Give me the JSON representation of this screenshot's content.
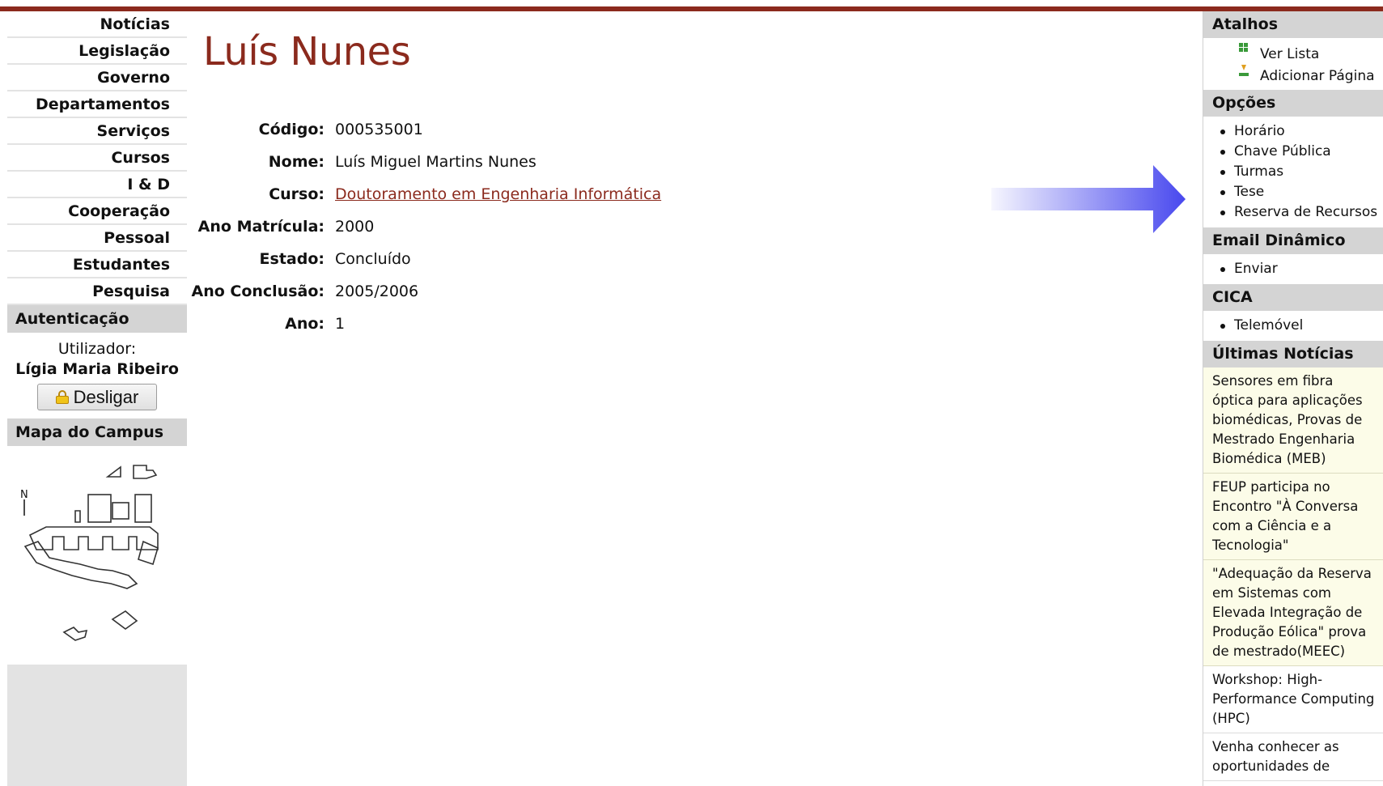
{
  "nav": [
    "Notícias",
    "Legislação",
    "Governo",
    "Departamentos",
    "Serviços",
    "Cursos",
    "I & D",
    "Cooperação",
    "Pessoal",
    "Estudantes",
    "Pesquisa"
  ],
  "auth": {
    "title": "Autenticação",
    "user_label": "Utilizador:",
    "user_name": "Lígia Maria Ribeiro",
    "logout_label": "Desligar"
  },
  "campus_map": {
    "title": "Mapa do Campus",
    "north_label": "N"
  },
  "person": {
    "title": "Luís Nunes",
    "fields": [
      {
        "label": "Código:",
        "value": "000535001"
      },
      {
        "label": "Nome:",
        "value": "Luís Miguel Martins Nunes"
      },
      {
        "label": "Curso:",
        "value": "Doutoramento em Engenharia Informática"
      },
      {
        "label": "Ano Matrícula:",
        "value": "2000"
      },
      {
        "label": "Estado:",
        "value": "Concluído"
      },
      {
        "label": "Ano Conclusão:",
        "value": "2005/2006"
      },
      {
        "label": "Ano:",
        "value": "1"
      }
    ]
  },
  "sidebar_right": {
    "shortcuts_title": "Atalhos",
    "shortcuts": [
      "Ver Lista",
      "Adicionar Página"
    ],
    "options_title": "Opções",
    "options": [
      "Horário",
      "Chave Pública",
      "Turmas",
      "Tese",
      "Reserva de Recursos"
    ],
    "email_title": "Email Dinâmico",
    "email_items": [
      "Enviar"
    ],
    "cica_title": "CICA",
    "cica_items": [
      "Telemóvel"
    ],
    "news_title": "Últimas Notícias",
    "news": [
      "Sensores em fibra óptica para aplicações biomédicas, Provas de Mestrado Engenharia Biomédica (MEB)",
      "FEUP participa no Encontro \"À Conversa com a Ciência e a Tecnologia\"",
      "\"Adequação da Reserva em Sistemas com Elevada Integração de Produção Eólica\" prova de mestrado(MEEC)",
      "Workshop: High-Performance Computing (HPC)",
      "Venha conhecer as oportunidades de"
    ]
  },
  "colors": {
    "brand": "#8b2a1d",
    "panel_gray": "#d4d4d4",
    "news_bg": "#fcfce8",
    "arrow": "#4848ee"
  }
}
